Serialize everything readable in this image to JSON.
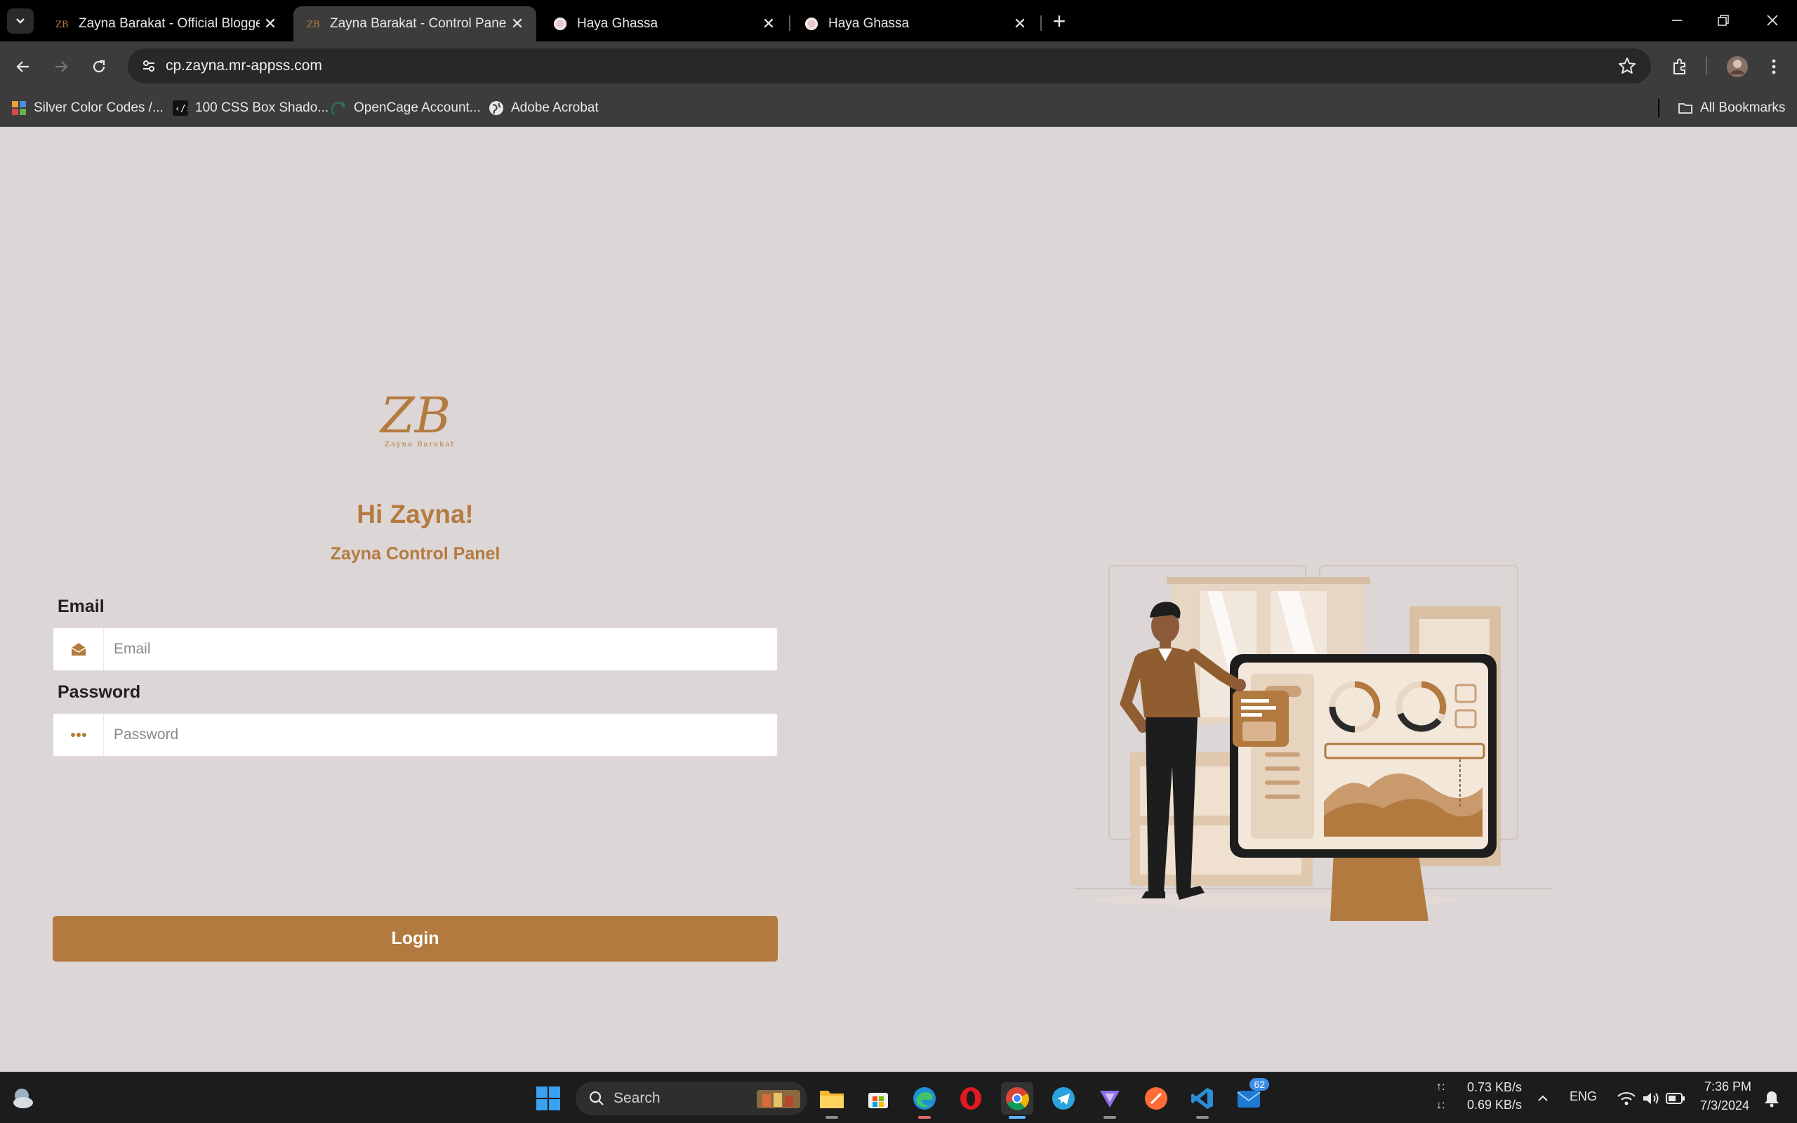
{
  "browser": {
    "tabs": [
      {
        "title": "Zayna Barakat - Official Blogger",
        "favicon": "zb-logo-icon",
        "active": false
      },
      {
        "title": "Zayna Barakat - Control Panel",
        "favicon": "zb-logo-icon",
        "active": true
      },
      {
        "title": "Haya Ghassa",
        "favicon": "haya-avatar-icon",
        "active": false
      },
      {
        "title": "Haya Ghassa",
        "favicon": "haya-avatar-icon",
        "active": false
      }
    ],
    "url": "cp.zayna.mr-appss.com",
    "bookmarks": [
      {
        "label": "Silver Color Codes /...",
        "icon": "colorful-grid-icon"
      },
      {
        "label": "100 CSS Box Shado...",
        "icon": "code-brackets-icon"
      },
      {
        "label": "OpenCage Account...",
        "icon": "opencage-icon"
      },
      {
        "label": "Adobe Acrobat",
        "icon": "globe-icon"
      }
    ],
    "all_bookmarks": "All Bookmarks"
  },
  "login": {
    "logo_text": "ZB",
    "logo_subtext": "Zayna Barakat",
    "greeting": "Hi Zayna!",
    "subtitle": "Zayna Control Panel",
    "email_label": "Email",
    "email_placeholder": "Email",
    "email_value": "",
    "password_label": "Password",
    "password_placeholder": "Password",
    "password_value": "",
    "login_button": "Login",
    "accent_color": "#b27a3f"
  },
  "taskbar": {
    "search_placeholder": "Search",
    "mail_badge": "62",
    "net_up": "0.73 KB/s",
    "net_down": "0.69 KB/s",
    "net_up_arrow": "↑:",
    "net_down_arrow": "↓:",
    "language": "ENG",
    "time": "7:36 PM",
    "date": "7/3/2024"
  }
}
